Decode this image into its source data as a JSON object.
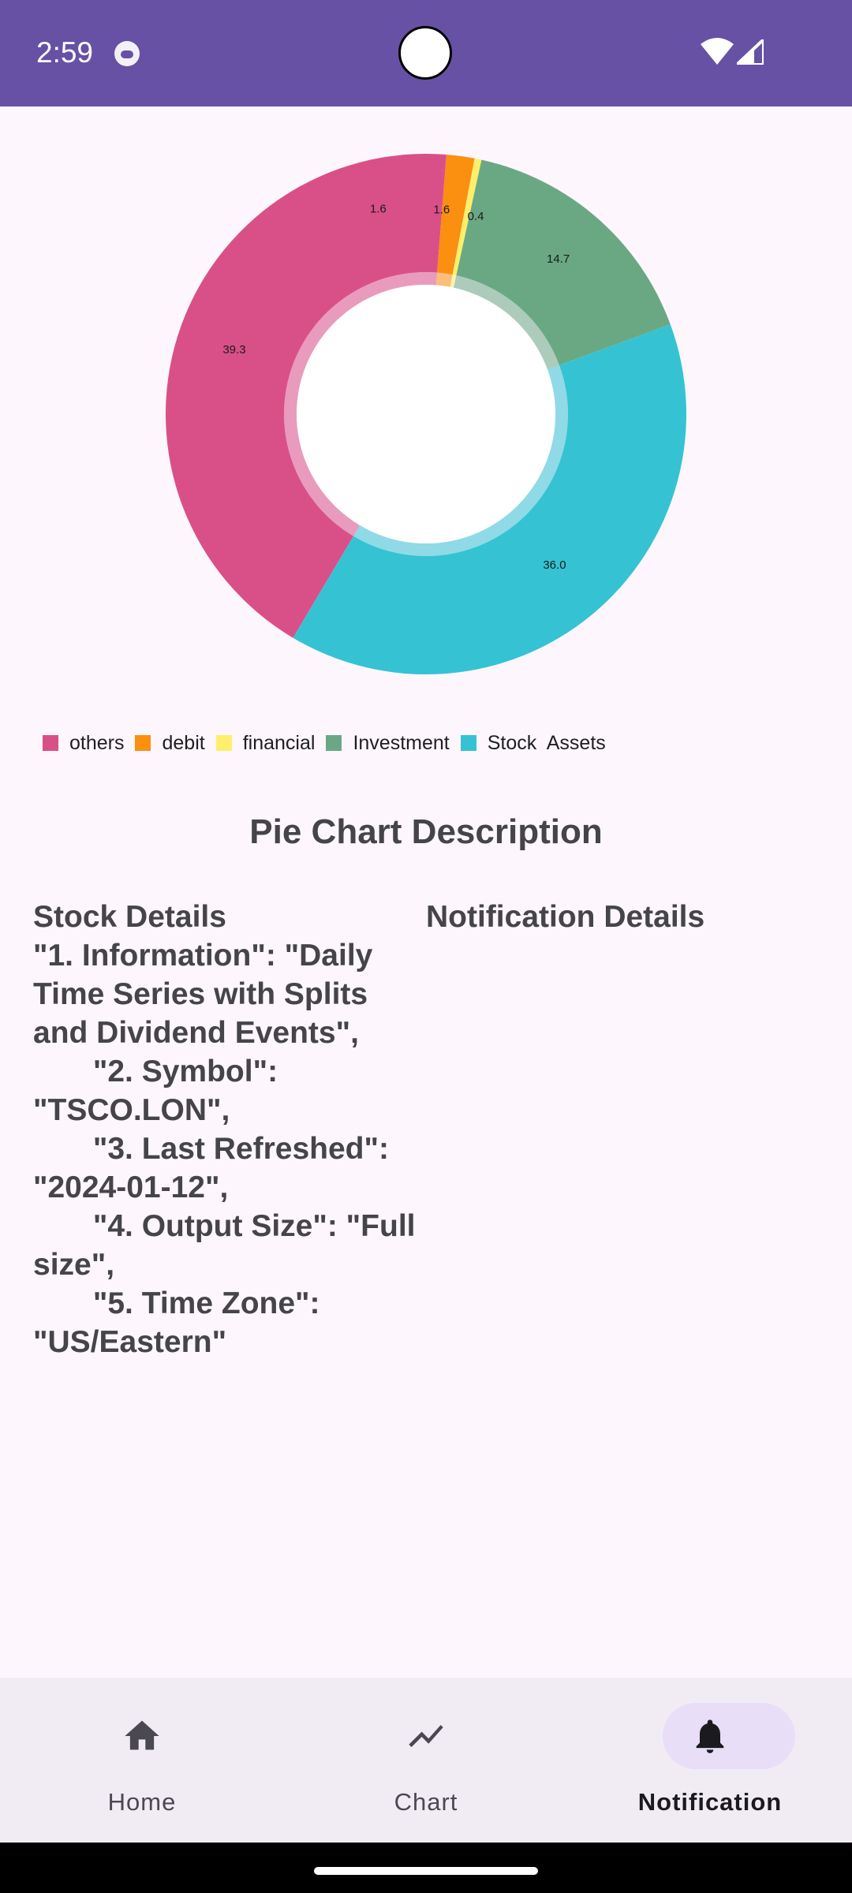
{
  "status_bar": {
    "time": "2:59",
    "background": "#6651a5"
  },
  "chart_data": {
    "type": "pie",
    "donut": true,
    "slices": [
      {
        "label": "others",
        "value": 39.3,
        "color": "#d95089",
        "label_text": "39.3"
      },
      {
        "label": "debit",
        "value": 1.6,
        "color": "#fa8f10",
        "label_text": "1.6"
      },
      {
        "label": "financial",
        "value": 0.4,
        "color": "#fdef6a",
        "label_text": "0.4"
      },
      {
        "label": "Investment",
        "value": 14.7,
        "color": "#6aa884",
        "label_text": "14.7"
      },
      {
        "label": "Stock  Assets",
        "value": 36.0,
        "color": "#35c3d3",
        "label_text": "36.0"
      }
    ],
    "extra_labels": [
      "1.6"
    ],
    "legend_placement": "bottom-left"
  },
  "legend": [
    {
      "label": "others",
      "color": "#d95089"
    },
    {
      "label": "debit",
      "color": "#fa8f10"
    },
    {
      "label": "financial",
      "color": "#fdef6a"
    },
    {
      "label": "Investment",
      "color": "#6aa884"
    },
    {
      "label": "Stock  Assets",
      "color": "#35c3d3"
    }
  ],
  "description": {
    "title": "Pie Chart Description",
    "stock_details": "Stock Details\n\"1. Information\": \"Daily Time Series with Splits and Dividend Events\",\n       \"2. Symbol\": \"TSCO.LON\",\n       \"3. Last Refreshed\": \"2024-01-12\",\n       \"4. Output Size\": \"Full size\",\n       \"5. Time Zone\": \"US/Eastern\"",
    "notification_details": "Notification Details"
  },
  "bottom_nav": {
    "items": [
      {
        "label": "Home",
        "icon": "home-icon",
        "active": false
      },
      {
        "label": "Chart",
        "icon": "chart-icon",
        "active": false
      },
      {
        "label": "Notification",
        "icon": "bell-icon",
        "active": true
      }
    ]
  }
}
